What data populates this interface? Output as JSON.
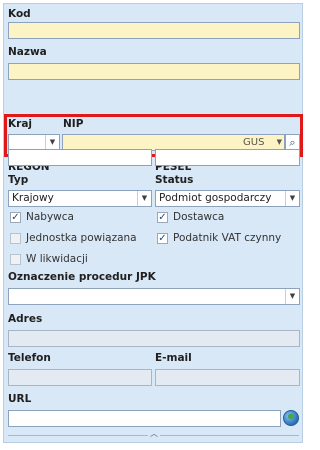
{
  "form": {
    "kod_label": "Kod",
    "nazwa_label": "Nazwa",
    "kraj_label": "Kraj",
    "nip_label": "NIP",
    "gus_label": "GUS",
    "regon_label": "REGON",
    "pesel_label": "PESEL",
    "typ_label": "Typ",
    "typ_value": "Krajowy",
    "status_label": "Status",
    "status_value": "Podmiot gospodarczy",
    "jpk_label": "Oznaczenie procedur JPK",
    "adres_label": "Adres",
    "telefon_label": "Telefon",
    "email_label": "E-mail",
    "url_label": "URL"
  },
  "checkboxes": {
    "nabywca": {
      "label": "Nabywca",
      "checked": true
    },
    "dostawca": {
      "label": "Dostawca",
      "checked": true
    },
    "jednostka": {
      "label": "Jednostka powiązana",
      "checked": false
    },
    "vat": {
      "label": "Podatnik VAT czynny",
      "checked": true
    },
    "likwidacji": {
      "label": "W likwidacji",
      "checked": false
    }
  },
  "icons": {
    "dropdown": "chevron-down-icon",
    "search": "magnifier-icon",
    "web": "globe-icon",
    "collapse": "chevron-up-icon"
  },
  "colors": {
    "panel_bg": "#d9e8f7",
    "required_field": "#fcf4c4",
    "highlight_border": "#e01818"
  }
}
